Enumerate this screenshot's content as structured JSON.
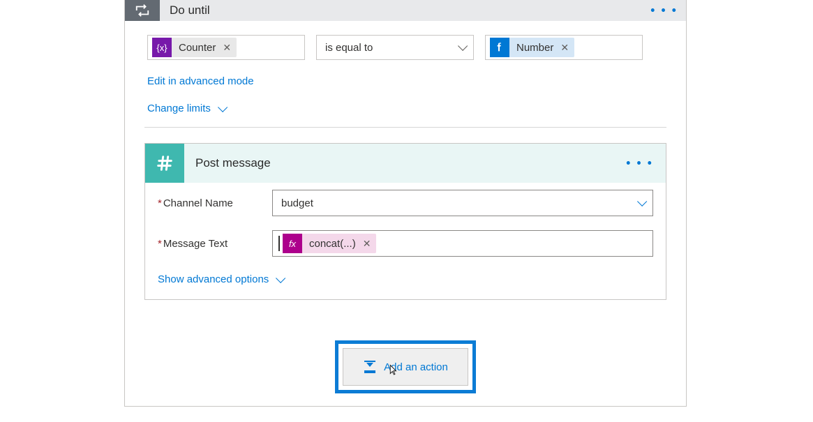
{
  "doUntil": {
    "title": "Do until",
    "left": {
      "pill_label": "Counter",
      "pill_icon_text": "{x}"
    },
    "operator": "is equal to",
    "right": {
      "pill_label": "Number"
    },
    "edit_link": "Edit in advanced mode",
    "limits_link": "Change limits"
  },
  "postMessage": {
    "title": "Post message",
    "channel_label": "Channel Name",
    "channel_value": "budget",
    "message_label": "Message Text",
    "fx_pill_icon": "fx",
    "fx_pill_label": "concat(...)",
    "show_advanced": "Show advanced options"
  },
  "addAction": {
    "label": "Add an action"
  }
}
